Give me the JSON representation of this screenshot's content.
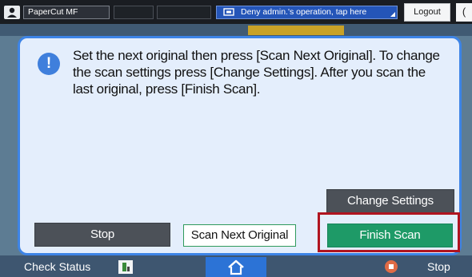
{
  "topbar": {
    "user_label": "PaperCut MF",
    "deny_text": "Deny admin.'s operation, tap here",
    "logout_label": "Logout",
    "right_glyph": "("
  },
  "dialog": {
    "message": "Set the next original then press [Scan Next Original]. To change the scan settings press [Change Settings]. After you scan the last original, press [Finish Scan].",
    "info_icon_glyph": "!",
    "buttons": {
      "change_settings": "Change Settings",
      "stop": "Stop",
      "scan_next": "Scan Next Original",
      "finish_scan": "Finish Scan"
    }
  },
  "bottombar": {
    "check_status": "Check Status",
    "stop": "Stop"
  },
  "colors": {
    "accent_blue": "#3d84e6",
    "finish_green": "#1e9a67",
    "highlight_red": "#b01420"
  },
  "icons": {
    "user": "user-icon",
    "deny": "monitor-icon",
    "info": "info-icon",
    "status": "status-icon",
    "home": "home-icon",
    "stop": "stop-icon"
  }
}
